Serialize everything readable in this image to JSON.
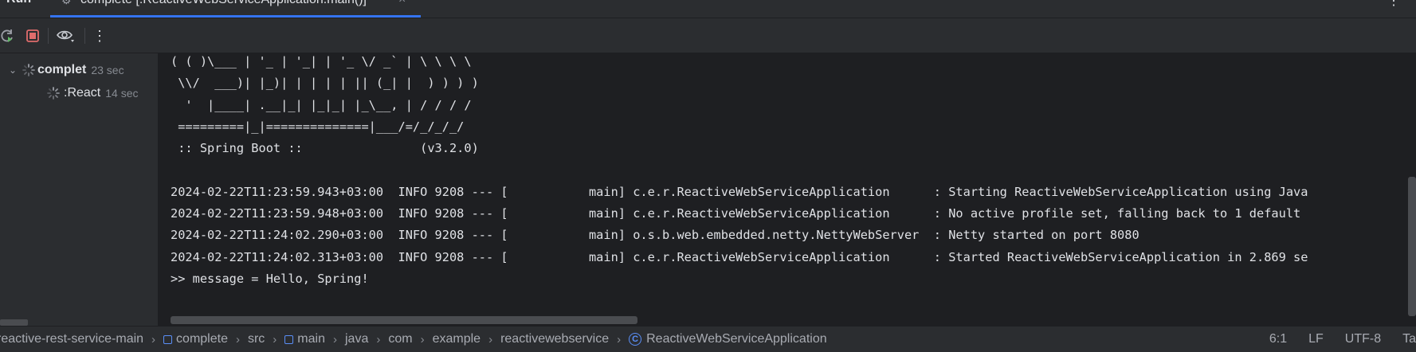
{
  "header": {
    "run_title": "Run",
    "tab_label": "complete [:ReactiveWebServiceApplication.main()]",
    "close_glyph": "×",
    "more_glyph": "⋮"
  },
  "toolbar": {
    "buttons": [
      "rerun-icon",
      "stop-icon",
      "view-icon",
      "more-vert-icon"
    ],
    "stop_color": "#e06c6c",
    "more_glyph": "⋮"
  },
  "tree": {
    "items": [
      {
        "name": "complet",
        "duration": "23 sec",
        "expanded": true
      },
      {
        "name": ":React",
        "duration": "14 sec"
      }
    ],
    "chevron": "⌄"
  },
  "console": {
    "lines": [
      "( ( )\\___ | '_ | '_| | '_ \\/ _` | \\ \\ \\ \\",
      " \\\\/  ___)| |_)| | | | | || (_| |  ) ) ) )",
      "  '  |____| .__|_| |_|_| |_\\__, | / / / /",
      " =========|_|==============|___/=/_/_/_/",
      " :: Spring Boot ::                (v3.2.0)",
      "",
      "2024-02-22T11:23:59.943+03:00  INFO 9208 --- [           main] c.e.r.ReactiveWebServiceApplication      : Starting ReactiveWebServiceApplication using Java",
      "2024-02-22T11:23:59.948+03:00  INFO 9208 --- [           main] c.e.r.ReactiveWebServiceApplication      : No active profile set, falling back to 1 default",
      "2024-02-22T11:24:02.290+03:00  INFO 9208 --- [           main] o.s.b.web.embedded.netty.NettyWebServer  : Netty started on port 8080",
      "2024-02-22T11:24:02.313+03:00  INFO 9208 --- [           main] c.e.r.ReactiveWebServiceApplication      : Started ReactiveWebServiceApplication in 2.869 se",
      ">> message = Hello, Spring!"
    ]
  },
  "statusbar": {
    "breadcrumbs": [
      {
        "label": "reactive-rest-service-main",
        "icon": ""
      },
      {
        "label": "complete",
        "icon": "module-icon"
      },
      {
        "label": "src",
        "icon": ""
      },
      {
        "label": "main",
        "icon": "module-icon"
      },
      {
        "label": "java",
        "icon": ""
      },
      {
        "label": "com",
        "icon": ""
      },
      {
        "label": "example",
        "icon": ""
      },
      {
        "label": "reactivewebservice",
        "icon": ""
      },
      {
        "label": "ReactiveWebServiceApplication",
        "icon": "class-icon"
      }
    ],
    "separator": "›",
    "class_icon_letter": "C",
    "position": "6:1",
    "line_sep": "LF",
    "encoding": "UTF-8",
    "indent": "Ta"
  }
}
